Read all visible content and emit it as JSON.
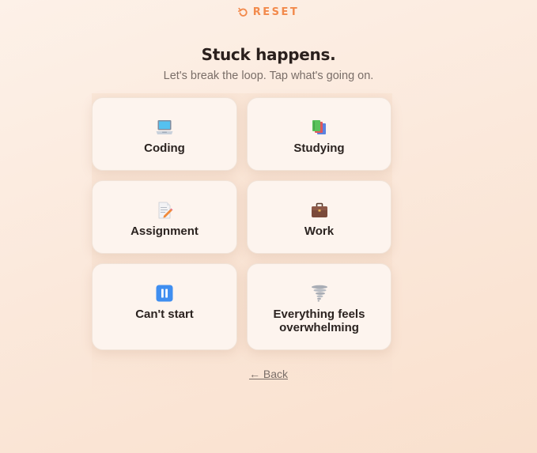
{
  "header": {
    "reset_label": "RESET",
    "reset_icon": "undo-icon"
  },
  "hero": {
    "title": "Stuck happens.",
    "subtitle": "Let's break the loop. Tap what's going on."
  },
  "options": [
    {
      "label": "Coding",
      "icon": "laptop-icon"
    },
    {
      "label": "Studying",
      "icon": "books-icon"
    },
    {
      "label": "Assignment",
      "icon": "memo-icon"
    },
    {
      "label": "Work",
      "icon": "briefcase-icon"
    },
    {
      "label": "Can't start",
      "icon": "pause-icon"
    },
    {
      "label": "Everything feels overwhelming",
      "icon": "tornado-icon"
    }
  ],
  "footer": {
    "back_label": "← Back"
  },
  "colors": {
    "accent": "#f28a4c",
    "text": "#2b2320",
    "muted": "#7a6e68",
    "card": "#fdf4ee"
  }
}
